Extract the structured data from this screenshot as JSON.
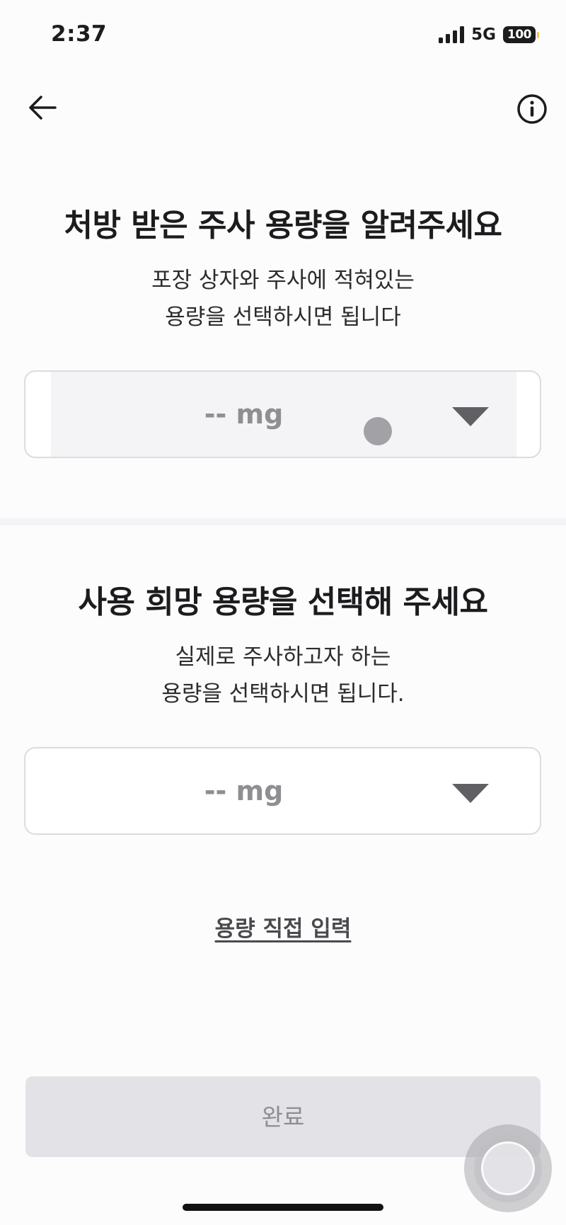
{
  "status_bar": {
    "time": "2:37",
    "network": "5G",
    "battery": "100"
  },
  "nav": {
    "back_icon": "arrow-left-icon",
    "info_icon": "info-circle-icon"
  },
  "prescribed": {
    "title": "처방 받은 주사 용량을 알려주세요",
    "description_line1": "포장 상자와 주사에 적혀있는",
    "description_line2": "용량을 선택하시면 됩니다",
    "select_value": "-- mg"
  },
  "desired": {
    "title": "사용 희망 용량을 선택해 주세요",
    "description_line1": "실제로 주사하고자 하는",
    "description_line2": "용량을 선택하시면 됩니다.",
    "select_value": "-- mg"
  },
  "manual_input_link": "용량 직접 입력",
  "done_button": "완료",
  "colors": {
    "background": "#fdfcfd",
    "text_primary": "#1c1c1e",
    "placeholder": "#8e8e93",
    "button_disabled": "#e3e2e6",
    "border": "#dcdce0"
  }
}
